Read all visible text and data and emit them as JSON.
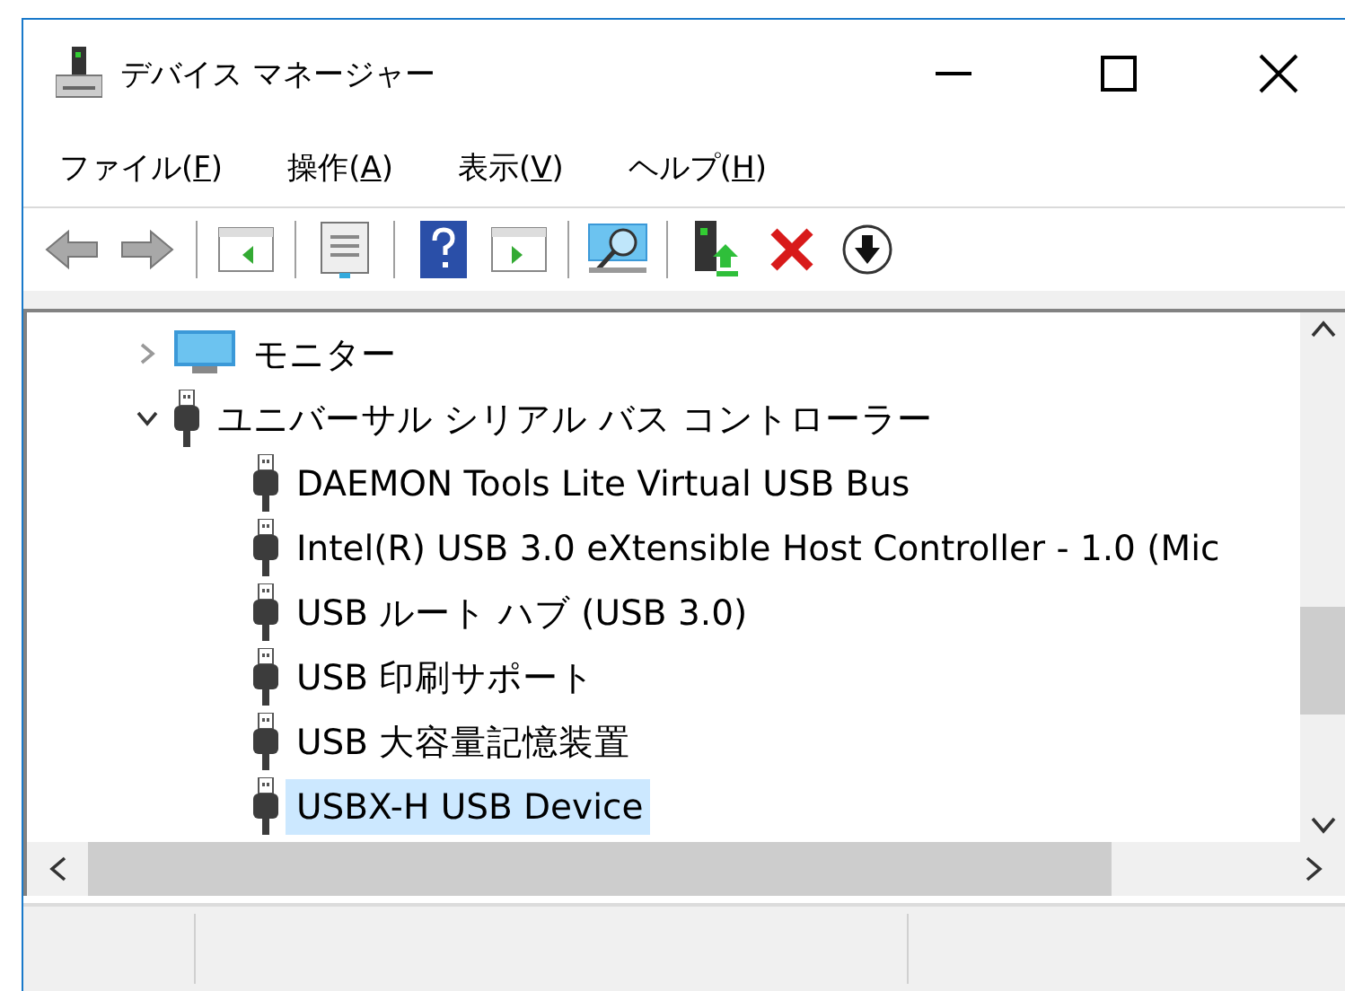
{
  "window": {
    "title": "デバイス マネージャー"
  },
  "menu": [
    {
      "label": "ファイル(",
      "access_key": "F",
      "label_end": ")"
    },
    {
      "label": "操作(",
      "access_key": "A",
      "label_end": ")"
    },
    {
      "label": "表示(",
      "access_key": "V",
      "label_end": ")"
    },
    {
      "label": "ヘルプ(",
      "access_key": "H",
      "label_end": ")"
    }
  ],
  "tree": [
    {
      "label": "モニター",
      "kind": "monitor",
      "expanded": false,
      "selected": false
    },
    {
      "label": "ユニバーサル シリアル バス コントローラー",
      "kind": "usb",
      "expanded": true,
      "selected": false,
      "children": [
        {
          "label": "DAEMON Tools Lite Virtual USB Bus",
          "kind": "usb",
          "selected": false
        },
        {
          "label": "Intel(R) USB 3.0 eXtensible Host Controller - 1.0 (Mic",
          "kind": "usb",
          "selected": false
        },
        {
          "label": "USB ルート ハブ (USB 3.0)",
          "kind": "usb",
          "selected": false
        },
        {
          "label": "USB 印刷サポート",
          "kind": "usb",
          "selected": false
        },
        {
          "label": "USB 大容量記憶装置",
          "kind": "usb",
          "selected": false
        },
        {
          "label": "USBX-H USB Device",
          "kind": "usb",
          "selected": true
        }
      ]
    }
  ]
}
